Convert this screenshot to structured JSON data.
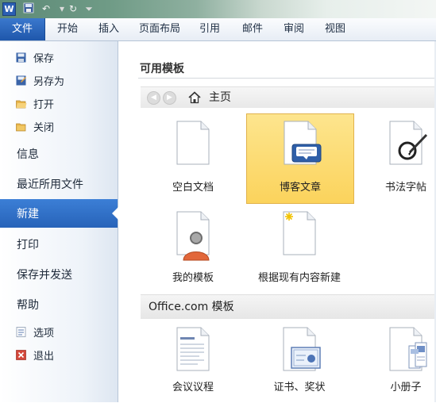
{
  "qat": {
    "logo": "W",
    "save_icon": "save-icon",
    "undo_icon": "undo-icon",
    "redo_icon": "redo-icon",
    "customize_icon": "customize-icon"
  },
  "ribbon": {
    "tabs": [
      {
        "label": "文件"
      },
      {
        "label": "开始"
      },
      {
        "label": "插入"
      },
      {
        "label": "页面布局"
      },
      {
        "label": "引用"
      },
      {
        "label": "邮件"
      },
      {
        "label": "审阅"
      },
      {
        "label": "视图"
      }
    ]
  },
  "backstage": {
    "commands": [
      {
        "label": "保存",
        "icon": "save-icon"
      },
      {
        "label": "另存为",
        "icon": "save-as-icon"
      },
      {
        "label": "打开",
        "icon": "open-folder-icon"
      },
      {
        "label": "关闭",
        "icon": "close-folder-icon"
      }
    ],
    "sections": [
      {
        "label": "信息"
      },
      {
        "label": "最近所用文件"
      },
      {
        "label": "新建",
        "active": true
      },
      {
        "label": "打印"
      },
      {
        "label": "保存并发送"
      },
      {
        "label": "帮助"
      }
    ],
    "footer": [
      {
        "label": "选项",
        "icon": "options-icon"
      },
      {
        "label": "退出",
        "icon": "exit-icon"
      }
    ]
  },
  "main": {
    "available_title": "可用模板",
    "nav": {
      "back_icon": "back-arrow-icon",
      "forward_icon": "forward-arrow-icon",
      "home_icon": "home-icon",
      "label": "主页"
    },
    "templates": [
      {
        "label": "空白文档",
        "icon": "blank-document-icon"
      },
      {
        "label": "博客文章",
        "icon": "blog-post-icon",
        "selected": true
      },
      {
        "label": "书法字帖",
        "icon": "calligraphy-icon"
      },
      {
        "label": "我的模板",
        "icon": "my-templates-icon"
      },
      {
        "label": "根据现有内容新建",
        "icon": "new-from-existing-icon"
      }
    ],
    "office_title": "Office.com 模板",
    "office_templates": [
      {
        "label": "会议议程",
        "icon": "agenda-icon"
      },
      {
        "label": "证书、奖状",
        "icon": "certificate-icon"
      },
      {
        "label": "小册子",
        "icon": "brochure-icon"
      }
    ]
  },
  "colors": {
    "accent": "#2b6cc4",
    "selected_tile": "#fcd76a"
  }
}
